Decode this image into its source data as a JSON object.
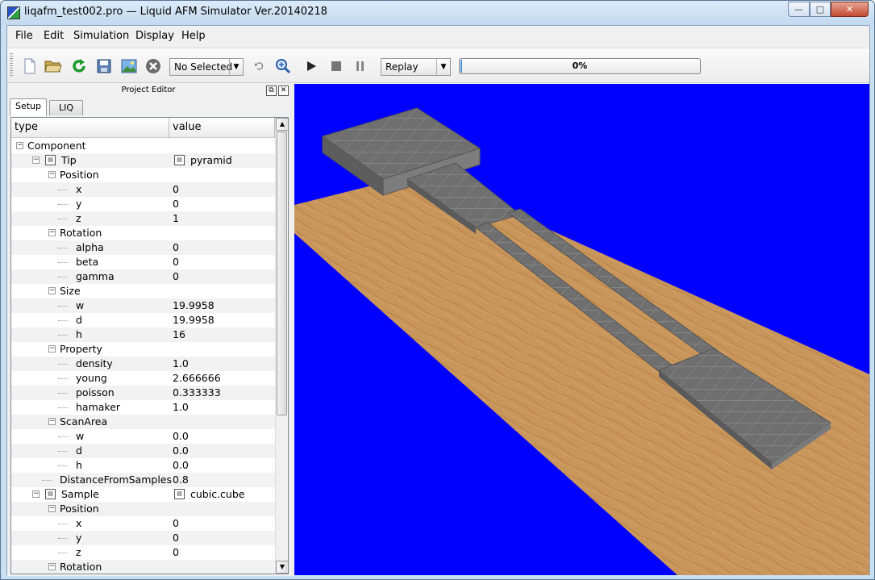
{
  "window": {
    "title": "liqafm_test002.pro — Liquid AFM Simulator Ver.20140218",
    "minimize": "—",
    "maximize": "□",
    "close": "✕"
  },
  "menu": [
    "File",
    "Edit",
    "Simulation",
    "Display",
    "Help"
  ],
  "toolbar": {
    "object_select": "No Selected",
    "replay_select": "Replay",
    "progress_text": "0%",
    "progress_value": 0.0
  },
  "dock": {
    "title": "Project Editor",
    "tabs": [
      "Setup",
      "LIQ"
    ],
    "columns": [
      "type",
      "value"
    ]
  },
  "tree": [
    {
      "label": "Component",
      "value": "",
      "level": 0,
      "exp": "-"
    },
    {
      "label": "Tip",
      "value": "pyramid",
      "level": 1,
      "exp": "-",
      "icon": true,
      "valicon": true
    },
    {
      "label": "Position",
      "value": "",
      "level": 2,
      "exp": "-"
    },
    {
      "label": "x",
      "value": "0",
      "level": 3
    },
    {
      "label": "y",
      "value": "0",
      "level": 3
    },
    {
      "label": "z",
      "value": "1",
      "level": 3
    },
    {
      "label": "Rotation",
      "value": "",
      "level": 2,
      "exp": "-"
    },
    {
      "label": "alpha",
      "value": "0",
      "level": 3
    },
    {
      "label": "beta",
      "value": "0",
      "level": 3
    },
    {
      "label": "gamma",
      "value": "0",
      "level": 3
    },
    {
      "label": "Size",
      "value": "",
      "level": 2,
      "exp": "-"
    },
    {
      "label": "w",
      "value": "19.9958",
      "level": 3
    },
    {
      "label": "d",
      "value": "19.9958",
      "level": 3
    },
    {
      "label": "h",
      "value": "16",
      "level": 3
    },
    {
      "label": "Property",
      "value": "",
      "level": 2,
      "exp": "-"
    },
    {
      "label": "density",
      "value": "1.0",
      "level": 3
    },
    {
      "label": "young",
      "value": "2.666666",
      "level": 3
    },
    {
      "label": "poisson",
      "value": "0.333333",
      "level": 3
    },
    {
      "label": "hamaker",
      "value": "1.0",
      "level": 3
    },
    {
      "label": "ScanArea",
      "value": "",
      "level": 2,
      "exp": "-"
    },
    {
      "label": "w",
      "value": "0.0",
      "level": 3
    },
    {
      "label": "d",
      "value": "0.0",
      "level": 3
    },
    {
      "label": "h",
      "value": "0.0",
      "level": 3
    },
    {
      "label": "DistanceFromSamples",
      "value": "0.8",
      "level": 2
    },
    {
      "label": "Sample",
      "value": "cubic.cube",
      "level": 1,
      "exp": "-",
      "icon": true,
      "valicon": true
    },
    {
      "label": "Position",
      "value": "",
      "level": 2,
      "exp": "-"
    },
    {
      "label": "x",
      "value": "0",
      "level": 3
    },
    {
      "label": "y",
      "value": "0",
      "level": 3
    },
    {
      "label": "z",
      "value": "0",
      "level": 3
    },
    {
      "label": "Rotation",
      "value": "",
      "level": 2,
      "exp": "-"
    }
  ],
  "colors": {
    "viewport_background": "#0000ff",
    "substrate": "#c8955a",
    "cube_gray": "#6e6e6e"
  }
}
